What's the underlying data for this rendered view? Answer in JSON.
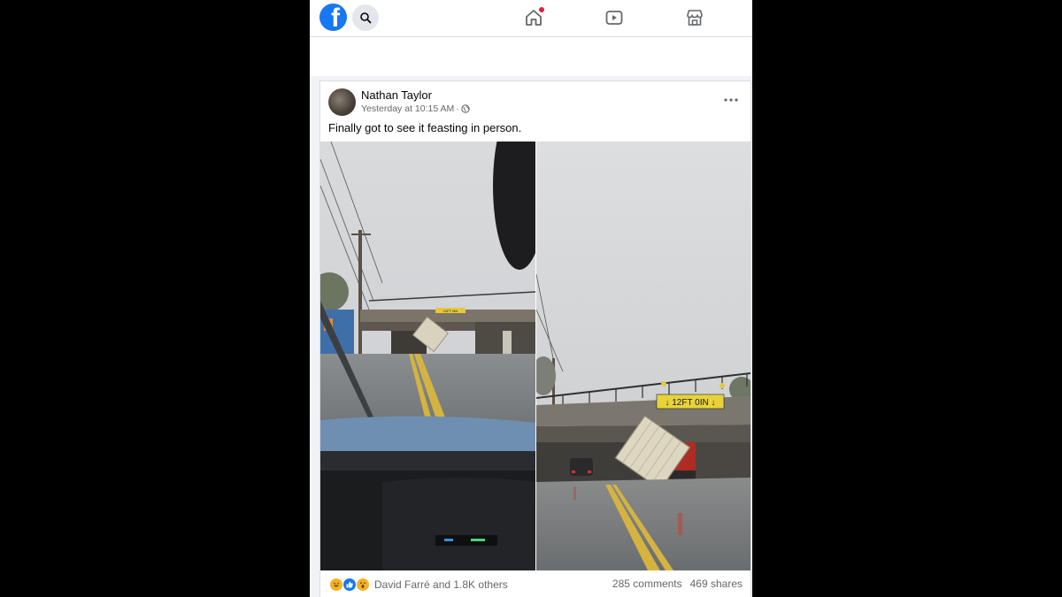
{
  "header": {
    "logo_letter": "f",
    "brand_color": "#1877f2",
    "notification_color": "#e41e3f",
    "icons": [
      "search-icon",
      "home-icon",
      "watch-icon",
      "marketplace-icon"
    ]
  },
  "post": {
    "author": "Nathan Taylor",
    "timestamp": "Yesterday at 10:15 AM",
    "separator": "·",
    "audience_icon": "globe-icon",
    "caption": "Finally got to see it feasting in person.",
    "more_icon": "more-options-icon",
    "photos": [
      {
        "name": "photo-windshield-view",
        "sign_text": "12FT 0IN"
      },
      {
        "name": "photo-truck-under-bridge",
        "sign_text": "↓ 12FT 0IN ↓"
      }
    ],
    "reactions": {
      "types": [
        "haha",
        "like",
        "wow"
      ],
      "summary": "David Farré and 1.8K others"
    },
    "comments": "285 comments",
    "shares": "469 shares"
  }
}
